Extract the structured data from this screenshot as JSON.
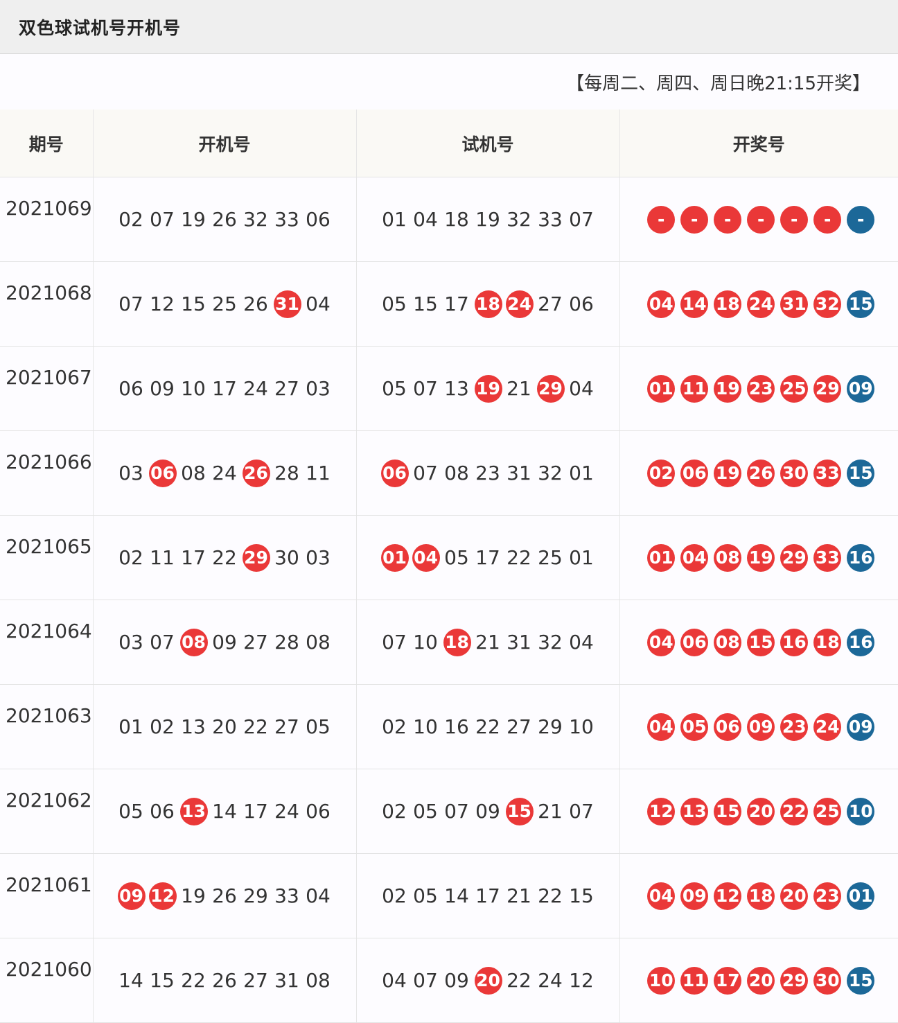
{
  "title": "双色球试机号开机号",
  "notice": "【每周二、周四、周日晚21:15开奖】",
  "headers": [
    "期号",
    "开机号",
    "试机号",
    "开奖号"
  ],
  "colors": {
    "red": "#ea3838",
    "blue": "#1c6898"
  },
  "rows": [
    {
      "issue": "2021069",
      "kaiji": [
        [
          "02",
          0
        ],
        [
          "07",
          0
        ],
        [
          "19",
          0
        ],
        [
          "26",
          0
        ],
        [
          "32",
          0
        ],
        [
          "33",
          0
        ],
        [
          "06",
          0
        ]
      ],
      "shiji": [
        [
          "01",
          0
        ],
        [
          "04",
          0
        ],
        [
          "18",
          0
        ],
        [
          "19",
          0
        ],
        [
          "32",
          0
        ],
        [
          "33",
          0
        ],
        [
          "07",
          0
        ]
      ],
      "red": [
        "-",
        "-",
        "-",
        "-",
        "-",
        "-"
      ],
      "blue": "-"
    },
    {
      "issue": "2021068",
      "kaiji": [
        [
          "07",
          0
        ],
        [
          "12",
          0
        ],
        [
          "15",
          0
        ],
        [
          "25",
          0
        ],
        [
          "26",
          0
        ],
        [
          "31",
          1
        ],
        [
          "04",
          0
        ]
      ],
      "shiji": [
        [
          "05",
          0
        ],
        [
          "15",
          0
        ],
        [
          "17",
          0
        ],
        [
          "18",
          1
        ],
        [
          "24",
          1
        ],
        [
          "27",
          0
        ],
        [
          "06",
          0
        ]
      ],
      "red": [
        "04",
        "14",
        "18",
        "24",
        "31",
        "32"
      ],
      "blue": "15"
    },
    {
      "issue": "2021067",
      "kaiji": [
        [
          "06",
          0
        ],
        [
          "09",
          0
        ],
        [
          "10",
          0
        ],
        [
          "17",
          0
        ],
        [
          "24",
          0
        ],
        [
          "27",
          0
        ],
        [
          "03",
          0
        ]
      ],
      "shiji": [
        [
          "05",
          0
        ],
        [
          "07",
          0
        ],
        [
          "13",
          0
        ],
        [
          "19",
          1
        ],
        [
          "21",
          0
        ],
        [
          "29",
          1
        ],
        [
          "04",
          0
        ]
      ],
      "red": [
        "01",
        "11",
        "19",
        "23",
        "25",
        "29"
      ],
      "blue": "09"
    },
    {
      "issue": "2021066",
      "kaiji": [
        [
          "03",
          0
        ],
        [
          "06",
          1
        ],
        [
          "08",
          0
        ],
        [
          "24",
          0
        ],
        [
          "26",
          1
        ],
        [
          "28",
          0
        ],
        [
          "11",
          0
        ]
      ],
      "shiji": [
        [
          "06",
          1
        ],
        [
          "07",
          0
        ],
        [
          "08",
          0
        ],
        [
          "23",
          0
        ],
        [
          "31",
          0
        ],
        [
          "32",
          0
        ],
        [
          "01",
          0
        ]
      ],
      "red": [
        "02",
        "06",
        "19",
        "26",
        "30",
        "33"
      ],
      "blue": "15"
    },
    {
      "issue": "2021065",
      "kaiji": [
        [
          "02",
          0
        ],
        [
          "11",
          0
        ],
        [
          "17",
          0
        ],
        [
          "22",
          0
        ],
        [
          "29",
          1
        ],
        [
          "30",
          0
        ],
        [
          "03",
          0
        ]
      ],
      "shiji": [
        [
          "01",
          1
        ],
        [
          "04",
          1
        ],
        [
          "05",
          0
        ],
        [
          "17",
          0
        ],
        [
          "22",
          0
        ],
        [
          "25",
          0
        ],
        [
          "01",
          0
        ]
      ],
      "red": [
        "01",
        "04",
        "08",
        "19",
        "29",
        "33"
      ],
      "blue": "16"
    },
    {
      "issue": "2021064",
      "kaiji": [
        [
          "03",
          0
        ],
        [
          "07",
          0
        ],
        [
          "08",
          1
        ],
        [
          "09",
          0
        ],
        [
          "27",
          0
        ],
        [
          "28",
          0
        ],
        [
          "08",
          0
        ]
      ],
      "shiji": [
        [
          "07",
          0
        ],
        [
          "10",
          0
        ],
        [
          "18",
          1
        ],
        [
          "21",
          0
        ],
        [
          "31",
          0
        ],
        [
          "32",
          0
        ],
        [
          "04",
          0
        ]
      ],
      "red": [
        "04",
        "06",
        "08",
        "15",
        "16",
        "18"
      ],
      "blue": "16"
    },
    {
      "issue": "2021063",
      "kaiji": [
        [
          "01",
          0
        ],
        [
          "02",
          0
        ],
        [
          "13",
          0
        ],
        [
          "20",
          0
        ],
        [
          "22",
          0
        ],
        [
          "27",
          0
        ],
        [
          "05",
          0
        ]
      ],
      "shiji": [
        [
          "02",
          0
        ],
        [
          "10",
          0
        ],
        [
          "16",
          0
        ],
        [
          "22",
          0
        ],
        [
          "27",
          0
        ],
        [
          "29",
          0
        ],
        [
          "10",
          0
        ]
      ],
      "red": [
        "04",
        "05",
        "06",
        "09",
        "23",
        "24"
      ],
      "blue": "09"
    },
    {
      "issue": "2021062",
      "kaiji": [
        [
          "05",
          0
        ],
        [
          "06",
          0
        ],
        [
          "13",
          1
        ],
        [
          "14",
          0
        ],
        [
          "17",
          0
        ],
        [
          "24",
          0
        ],
        [
          "06",
          0
        ]
      ],
      "shiji": [
        [
          "02",
          0
        ],
        [
          "05",
          0
        ],
        [
          "07",
          0
        ],
        [
          "09",
          0
        ],
        [
          "15",
          1
        ],
        [
          "21",
          0
        ],
        [
          "07",
          0
        ]
      ],
      "red": [
        "12",
        "13",
        "15",
        "20",
        "22",
        "25"
      ],
      "blue": "10"
    },
    {
      "issue": "2021061",
      "kaiji": [
        [
          "09",
          1
        ],
        [
          "12",
          1
        ],
        [
          "19",
          0
        ],
        [
          "26",
          0
        ],
        [
          "29",
          0
        ],
        [
          "33",
          0
        ],
        [
          "04",
          0
        ]
      ],
      "shiji": [
        [
          "02",
          0
        ],
        [
          "05",
          0
        ],
        [
          "14",
          0
        ],
        [
          "17",
          0
        ],
        [
          "21",
          0
        ],
        [
          "22",
          0
        ],
        [
          "15",
          0
        ]
      ],
      "red": [
        "04",
        "09",
        "12",
        "18",
        "20",
        "23"
      ],
      "blue": "01"
    },
    {
      "issue": "2021060",
      "kaiji": [
        [
          "14",
          0
        ],
        [
          "15",
          0
        ],
        [
          "22",
          0
        ],
        [
          "26",
          0
        ],
        [
          "27",
          0
        ],
        [
          "31",
          0
        ],
        [
          "08",
          0
        ]
      ],
      "shiji": [
        [
          "04",
          0
        ],
        [
          "07",
          0
        ],
        [
          "09",
          0
        ],
        [
          "20",
          1
        ],
        [
          "22",
          0
        ],
        [
          "24",
          0
        ],
        [
          "12",
          0
        ]
      ],
      "red": [
        "10",
        "11",
        "17",
        "20",
        "29",
        "30"
      ],
      "blue": "15"
    }
  ]
}
